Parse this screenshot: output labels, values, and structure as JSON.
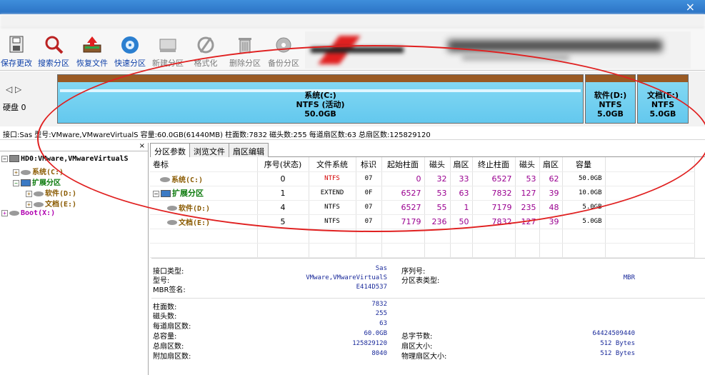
{
  "window": {
    "close_glyph": "×"
  },
  "toolbar": {
    "items": [
      {
        "label": "保存更改",
        "icon": "save-icon"
      },
      {
        "label": "搜索分区",
        "icon": "search-icon"
      },
      {
        "label": "恢复文件",
        "icon": "restore-icon"
      },
      {
        "label": "快速分区",
        "icon": "quick-partition-icon"
      },
      {
        "label": "新建分区",
        "icon": "new-partition-icon"
      },
      {
        "label": "格式化",
        "icon": "format-icon"
      },
      {
        "label": "删除分区",
        "icon": "delete-icon"
      },
      {
        "label": "备份分区",
        "icon": "backup-icon"
      }
    ]
  },
  "diskbar": {
    "nav": "◁ ▷",
    "disk_label": "硬盘 0",
    "partitions": [
      {
        "name": "系统(C:)",
        "fs": "NTFS (活动)",
        "size": "50.0GB"
      },
      {
        "name": "软件(D:)",
        "fs": "NTFS",
        "size": "5.0GB"
      },
      {
        "name": "文档(E:)",
        "fs": "NTFS",
        "size": "5.0GB"
      }
    ]
  },
  "info": {
    "text": "接口:Sas  型号:VMware,VMwareVirtualS  容量:60.0GB(61440MB)  柱面数:7832  磁头数:255  每道扇区数:63  总扇区数:125829120"
  },
  "tree": {
    "close": "×",
    "disk": "HD0:VMware,VMwareVirtualS",
    "c": "系统(C:)",
    "ext": "扩展分区",
    "d": "软件(D:)",
    "e": "文档(E:)",
    "boot": "Boot(X:)"
  },
  "tabs": [
    "分区参数",
    "浏览文件",
    "扇区编辑"
  ],
  "table": {
    "headers": [
      "卷标",
      "序号(状态)",
      "文件系统",
      "标识",
      "起始柱面",
      "磁头",
      "扇区",
      "终止柱面",
      "磁头",
      "扇区",
      "容量"
    ],
    "rows": [
      {
        "label": "系统(C:)",
        "seq": "0",
        "fs": "NTFS",
        "id": "07",
        "sc": "0",
        "sh": "32",
        "ss": "33",
        "ec": "6527",
        "eh": "53",
        "es": "62",
        "cap": "50.0GB"
      },
      {
        "label": "扩展分区",
        "seq": "1",
        "fs": "EXTEND",
        "id": "0F",
        "sc": "6527",
        "sh": "53",
        "ss": "63",
        "ec": "7832",
        "eh": "127",
        "es": "39",
        "cap": "10.0GB"
      },
      {
        "label": "软件(D:)",
        "seq": "4",
        "fs": "NTFS",
        "id": "07",
        "sc": "6527",
        "sh": "55",
        "ss": "1",
        "ec": "7179",
        "eh": "235",
        "es": "48",
        "cap": "5.0GB"
      },
      {
        "label": "文档(E:)",
        "seq": "5",
        "fs": "NTFS",
        "id": "07",
        "sc": "7179",
        "sh": "236",
        "ss": "50",
        "ec": "7832",
        "eh": "127",
        "es": "39",
        "cap": "5.0GB"
      }
    ]
  },
  "details": {
    "iface_l": "接口类型:",
    "iface_v": "Sas",
    "model_l": "型号:",
    "model_v": "VMware,VMwareVirtualS",
    "mbr_l": "MBR签名:",
    "mbr_v": "E414D537",
    "serial_l": "序列号:",
    "pt_l": "分区表类型:",
    "pt_v": "MBR",
    "cyl_l": "柱面数:",
    "cyl_v": "7832",
    "heads_l": "磁头数:",
    "heads_v": "255",
    "spt_l": "每道扇区数:",
    "spt_v": "63",
    "cap_l": "总容量:",
    "cap_v": "60.0GB",
    "bytes_l": "总字节数:",
    "bytes_v": "64424509440",
    "sect_l": "总扇区数:",
    "sect_v": "125829120",
    "ss_l": "扇区大小:",
    "ss_v": "512 Bytes",
    "extra_l": "附加扇区数:",
    "extra_v": "8040",
    "pss_l": "物理扇区大小:",
    "pss_v": "512 Bytes"
  }
}
